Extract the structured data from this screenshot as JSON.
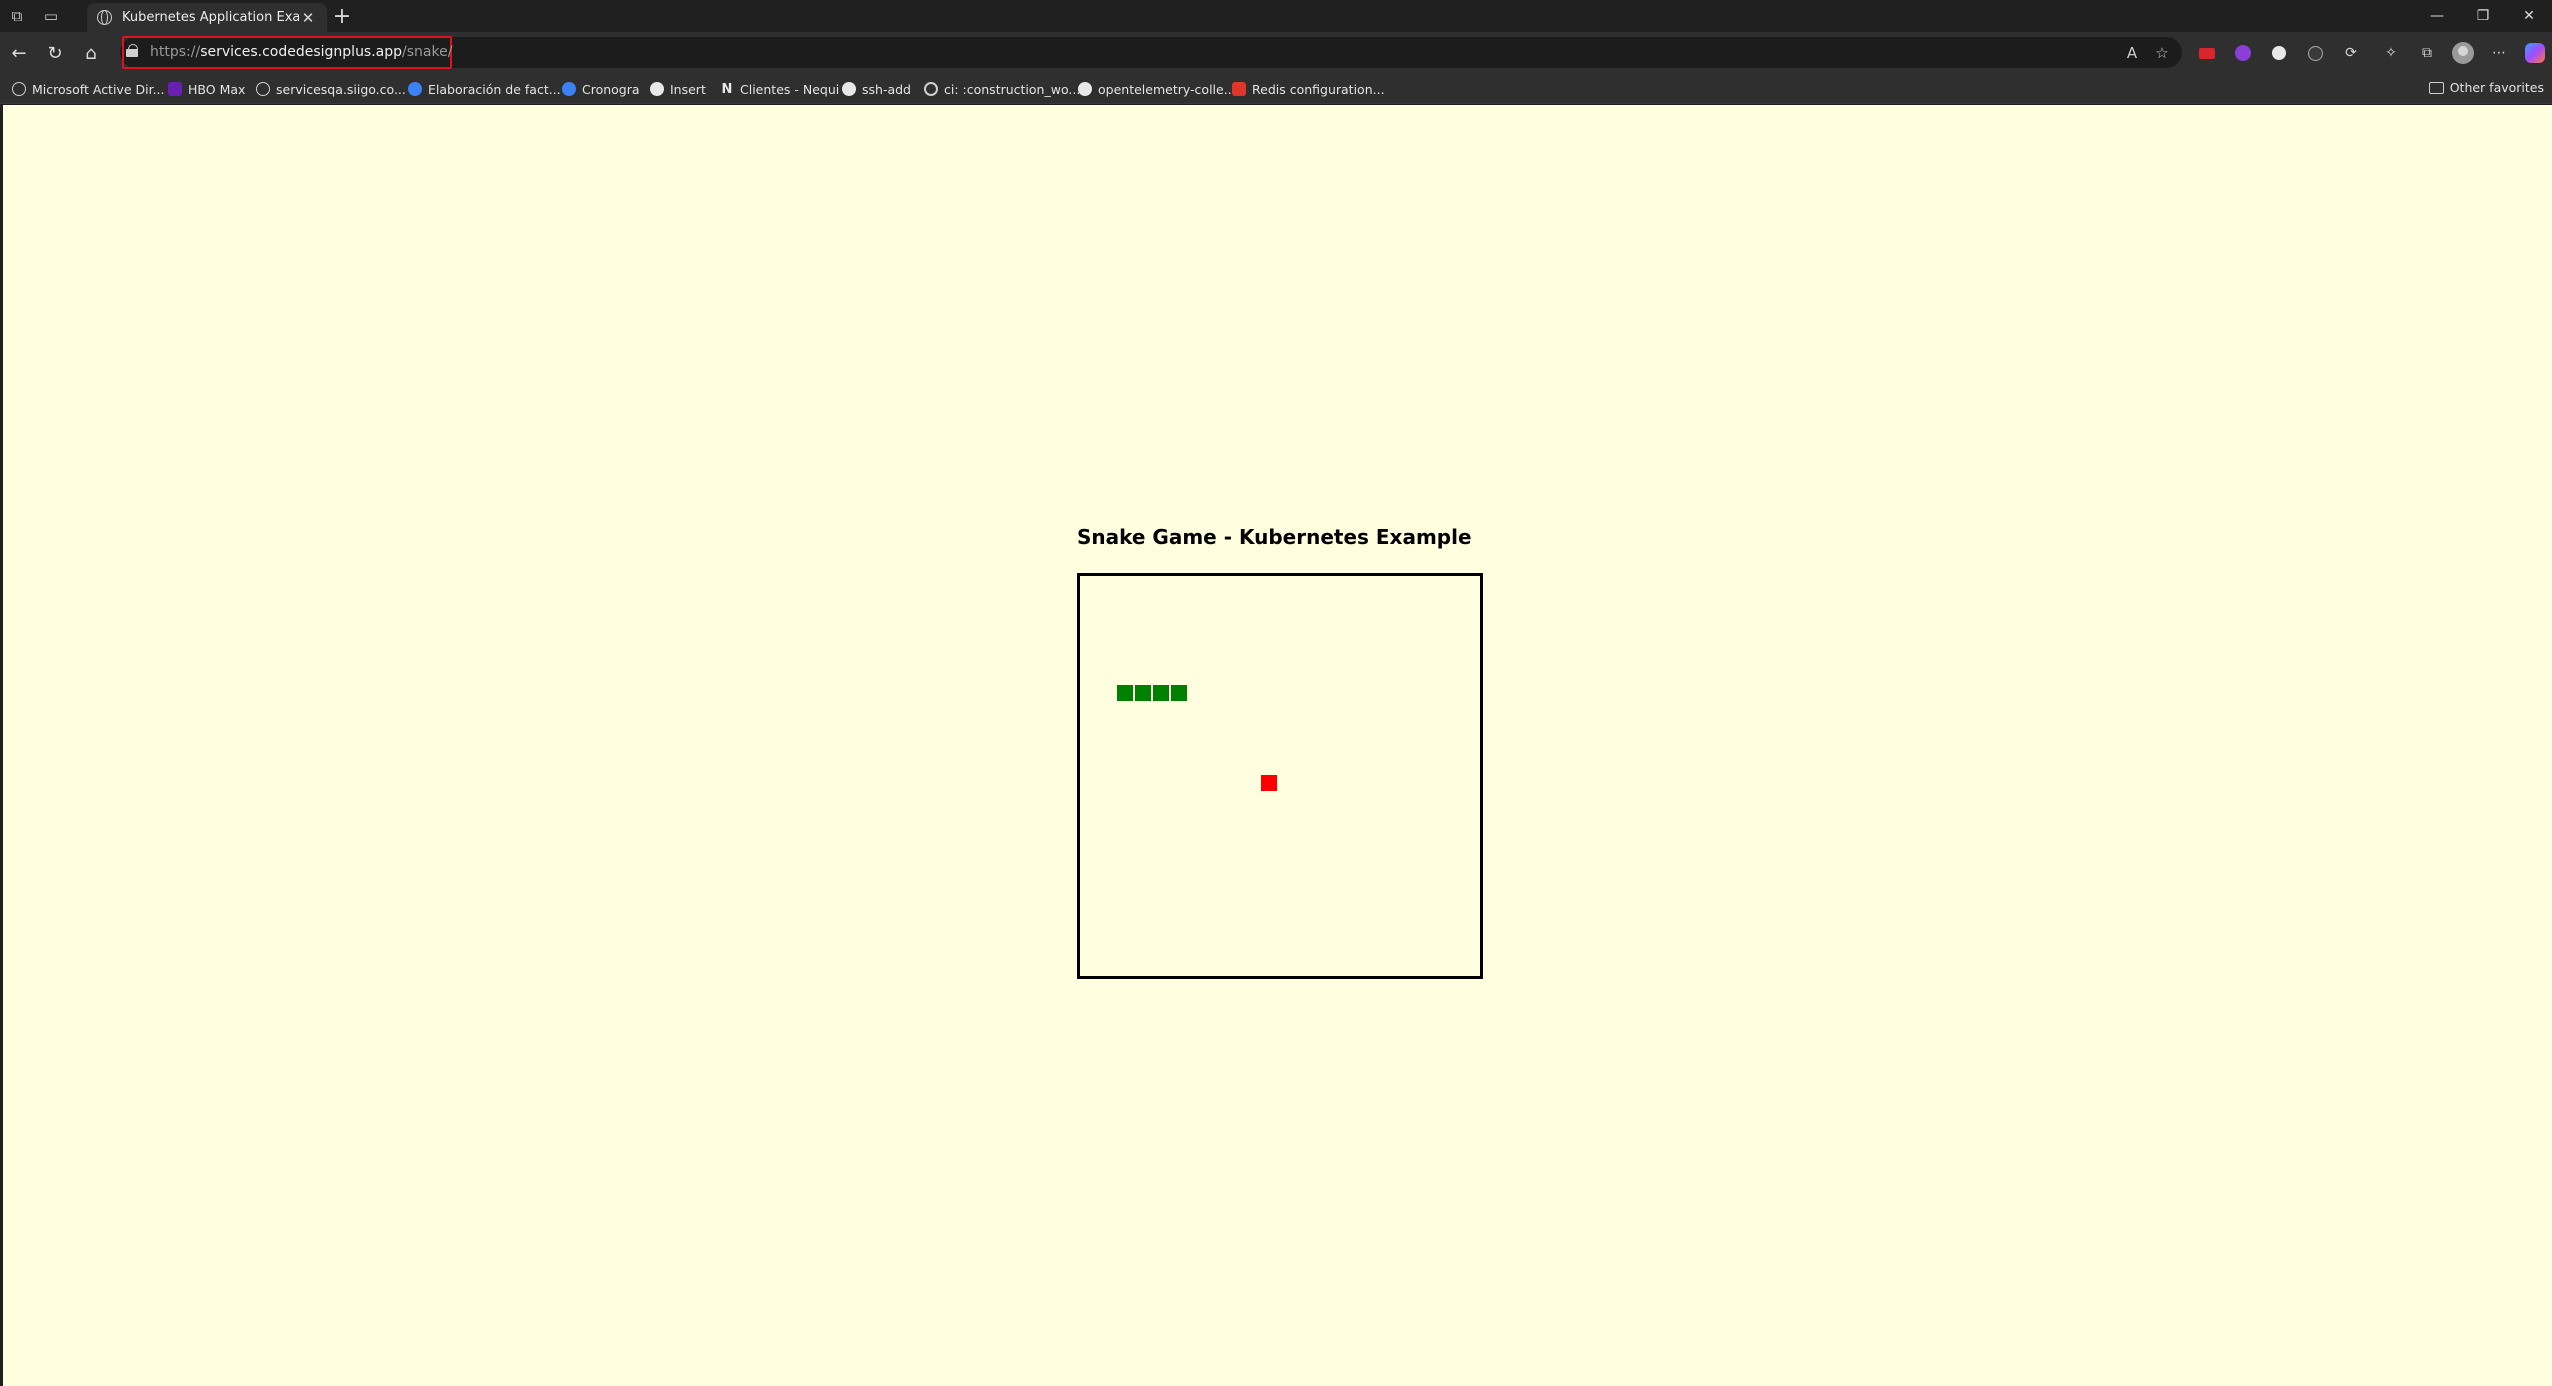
{
  "browser": {
    "tab": {
      "title": "Kubernetes Application Example",
      "icon": "globe-icon"
    },
    "address": {
      "protocol": "https://",
      "host": "services.codedesignplus.app",
      "path": "/snake/"
    },
    "bookmarks": [
      {
        "label": "Microsoft Active Dir...",
        "icon": "globe-icon"
      },
      {
        "label": "HBO Max",
        "icon": "hbo-icon"
      },
      {
        "label": "servicesqa.siigo.co...",
        "icon": "globe-icon"
      },
      {
        "label": "Elaboración de fact...",
        "icon": "blue-circle-icon"
      },
      {
        "label": "Cronogra",
        "icon": "blue-circle-icon"
      },
      {
        "label": "Insert",
        "icon": "github-icon"
      },
      {
        "label": "Clientes - Nequi",
        "icon": "notion-icon"
      },
      {
        "label": "ssh-add",
        "icon": "github-icon"
      },
      {
        "label": "ci: :construction_wo...",
        "icon": "ring-icon"
      },
      {
        "label": "opentelemetry-colle...",
        "icon": "github-icon"
      },
      {
        "label": "Redis configuration...",
        "icon": "redis-icon"
      }
    ],
    "other_favorites": "Other favorites"
  },
  "game": {
    "title": "Snake Game - Kubernetes Example",
    "grid_size": 20,
    "snake": [
      [
        5,
        6
      ],
      [
        4,
        6
      ],
      [
        3,
        6
      ],
      [
        2,
        6
      ]
    ],
    "food": [
      10,
      11
    ],
    "colors": {
      "snake": "#008000",
      "food": "#ff0000",
      "background": "#ffffe0"
    }
  }
}
